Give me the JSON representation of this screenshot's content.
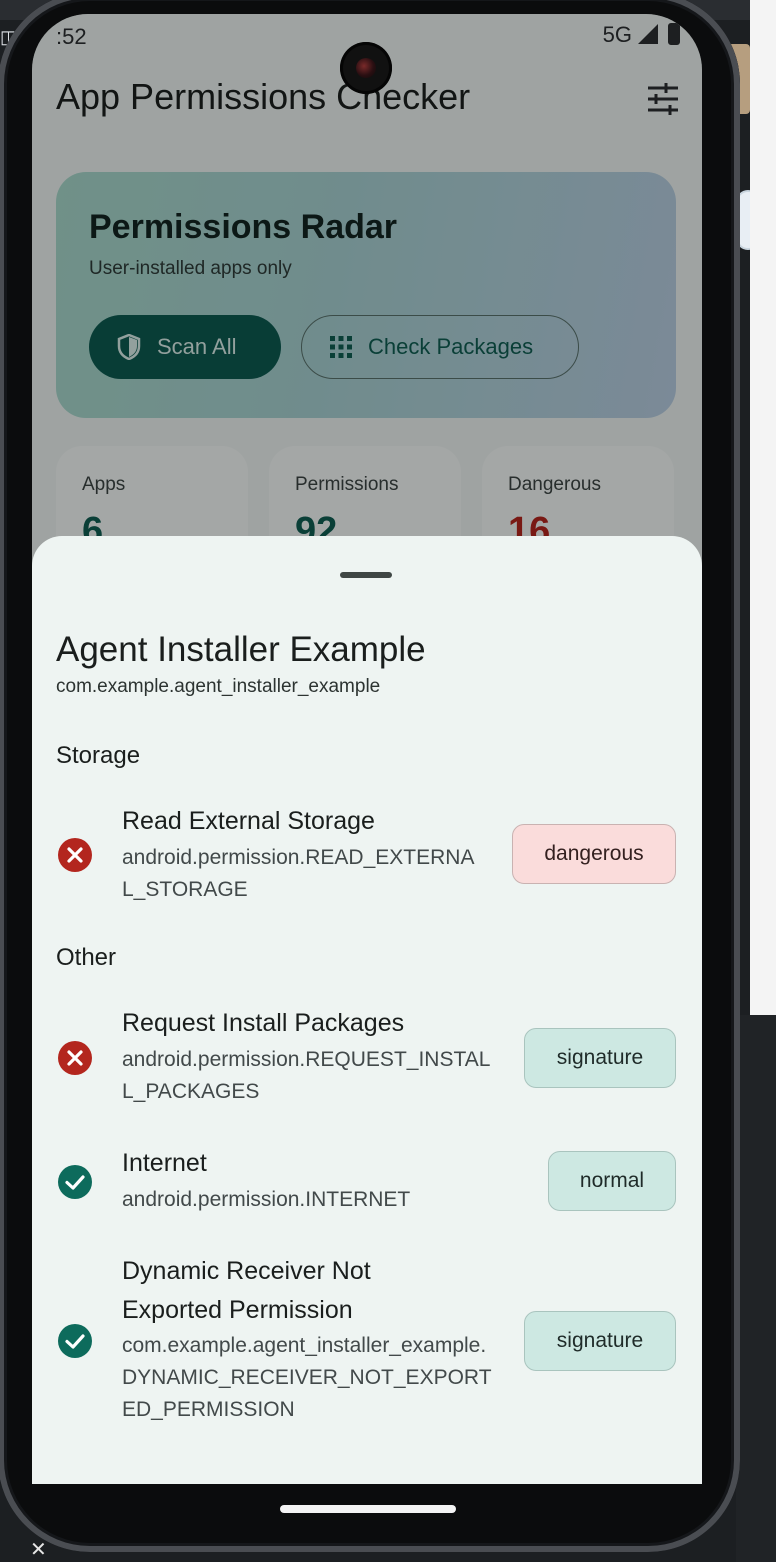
{
  "status_bar": {
    "time": ":52",
    "network": "5G"
  },
  "app_bar": {
    "title": "App Permissions Checker",
    "filter_icon": "tune-icon"
  },
  "radar": {
    "title": "Permissions Radar",
    "subtitle": "User-installed apps only",
    "scan_all_label": "Scan All",
    "check_packages_label": "Check Packages"
  },
  "stats": [
    {
      "label": "Apps",
      "value": "6"
    },
    {
      "label": "Permissions",
      "value": "92"
    },
    {
      "label": "Dangerous",
      "value": "16"
    }
  ],
  "sheet": {
    "app_name": "Agent Installer Example",
    "package_name": "com.example.agent_installer_example",
    "sections": [
      {
        "heading": "Storage",
        "permissions": [
          {
            "title": "Read External Storage",
            "identifier": "android.permission.READ_EXTERNAL_STORAGE",
            "protection": "dangerous",
            "granted": false
          }
        ]
      },
      {
        "heading": "Other",
        "permissions": [
          {
            "title": "Request Install Packages",
            "identifier": "android.permission.REQUEST_INSTALL_PACKAGES",
            "protection": "signature",
            "granted": false
          },
          {
            "title": "Internet",
            "identifier": "android.permission.INTERNET",
            "protection": "normal",
            "granted": true
          },
          {
            "title": "Dynamic Receiver Not Exported Permission",
            "identifier": "com.example.agent_installer_example.DYNAMIC_RECEIVER_NOT_EXPORTED_PERMISSION",
            "protection": "signature",
            "granted": true
          }
        ]
      }
    ]
  },
  "colors": {
    "primary": "#0c5a50",
    "danger_red": "#b3261e",
    "granted_green": "#0d6b5c",
    "sheet_bg": "#eef4f2"
  }
}
